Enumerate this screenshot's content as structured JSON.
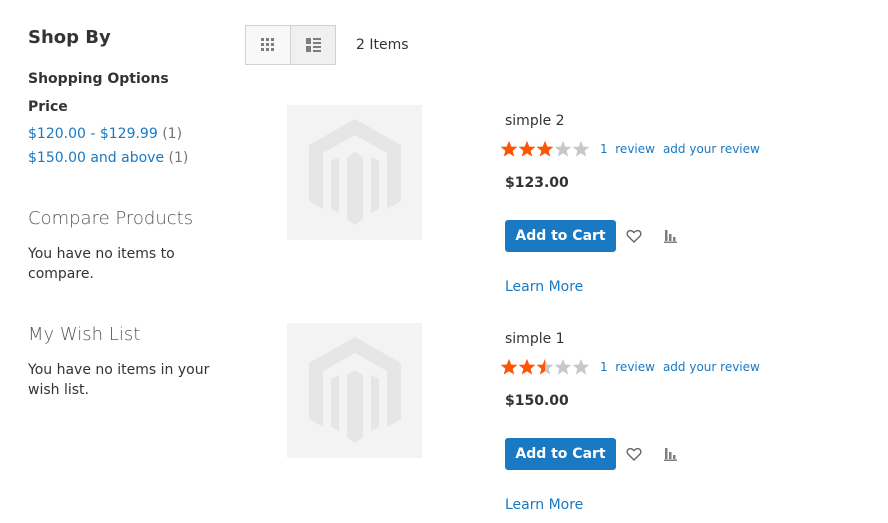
{
  "sidebar": {
    "shop_by": "Shop By",
    "shopping_options": "Shopping Options",
    "price_title": "Price",
    "filters": [
      {
        "label": "$120.00 - $129.99",
        "count": "(1)"
      },
      {
        "label": "$150.00 and above",
        "count": "(1)"
      }
    ],
    "compare": {
      "title": "Compare Products",
      "empty": "You have no items to compare."
    },
    "wishlist": {
      "title": "My Wish List",
      "empty": "You have no items in your wish list."
    }
  },
  "toolbar": {
    "amount": "2 Items"
  },
  "products": [
    {
      "name": "simple 2",
      "rating_fraction": 0.6,
      "reviews_label": "1  review",
      "add_review_label": "add your review",
      "price": "$123.00",
      "add_to_cart": "Add to Cart",
      "learn_more": "Learn More"
    },
    {
      "name": "simple 1",
      "rating_fraction": 0.5,
      "reviews_label": "1  review",
      "add_review_label": "add your review",
      "price": "$150.00",
      "add_to_cart": "Add to Cart",
      "learn_more": "Learn More"
    }
  ],
  "colors": {
    "link": "#1979c3",
    "button": "#1979c3",
    "star_filled": "#ff5501",
    "star_empty": "#c7c7c7"
  }
}
